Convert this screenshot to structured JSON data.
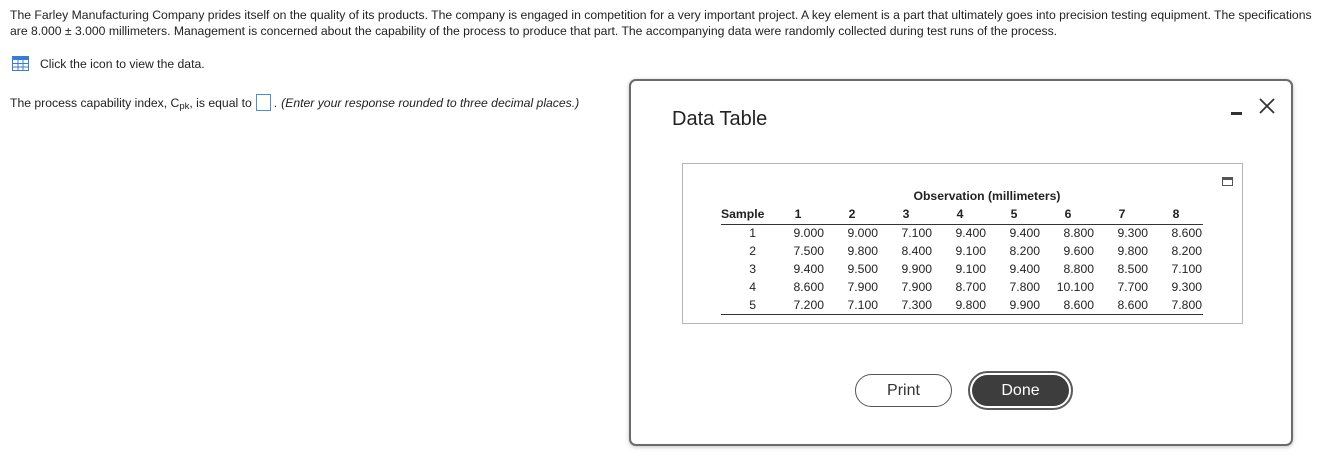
{
  "problem": {
    "text": "The Farley Manufacturing Company prides itself on the quality of its products. The company is engaged in competition for a very important project. A key element is a part that ultimately goes into precision testing equipment. The specifications are 8.000 ± 3.000 millimeters. Management is concerned about the capability of the process to produce that part. The accompanying data were randomly collected during test runs of the process."
  },
  "data_link": {
    "label": "Click the icon to view the data.",
    "icon": "table-grid-icon"
  },
  "question": {
    "prefix": "The process capability index, C",
    "subscript": "pk",
    "middle": ", is equal to",
    "answer_value": "",
    "suffix": ".",
    "hint": "(Enter your response rounded to three decimal places.)"
  },
  "dialog": {
    "title": "Data Table",
    "minimize_icon": "minimize-icon",
    "close_icon": "close-icon",
    "popout_icon": "popout-icon",
    "table": {
      "group_header": "Observation (millimeters)",
      "sample_header": "Sample",
      "columns": [
        "1",
        "2",
        "3",
        "4",
        "5",
        "6",
        "7",
        "8"
      ],
      "rows": [
        {
          "sample": "1",
          "values": [
            "9.000",
            "9.000",
            "7.100",
            "9.400",
            "9.400",
            "8.800",
            "9.300",
            "8.600"
          ]
        },
        {
          "sample": "2",
          "values": [
            "7.500",
            "9.800",
            "8.400",
            "9.100",
            "8.200",
            "9.600",
            "9.800",
            "8.200"
          ]
        },
        {
          "sample": "3",
          "values": [
            "9.400",
            "9.500",
            "9.900",
            "9.100",
            "9.400",
            "8.800",
            "8.500",
            "7.100"
          ]
        },
        {
          "sample": "4",
          "values": [
            "8.600",
            "7.900",
            "7.900",
            "8.700",
            "7.800",
            "10.100",
            "7.700",
            "9.300"
          ]
        },
        {
          "sample": "5",
          "values": [
            "7.200",
            "7.100",
            "7.300",
            "9.800",
            "9.900",
            "8.600",
            "8.600",
            "7.800"
          ]
        }
      ]
    },
    "print_label": "Print",
    "done_label": "Done"
  },
  "colors": {
    "accent": "#4a90d9",
    "done_bg": "#3d3d3d",
    "icon_blue": "#3a7bd5"
  }
}
